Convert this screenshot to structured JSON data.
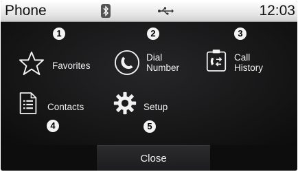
{
  "status": {
    "title": "Phone",
    "time": "12:03"
  },
  "menu": {
    "favorites": {
      "badge": "1",
      "label": "Favorites"
    },
    "dial": {
      "badge": "2",
      "line1": "Dial",
      "line2": "Number"
    },
    "history": {
      "badge": "3",
      "line1": "Call",
      "line2": "History"
    },
    "contacts": {
      "badge": "4",
      "label": "Contacts"
    },
    "setup": {
      "badge": "5",
      "label": "Setup"
    }
  },
  "footer": {
    "close_label": "Close"
  },
  "icons": [
    "bluetooth-icon",
    "usb-icon",
    "star-icon",
    "phone-handset-icon",
    "call-history-icon",
    "contacts-icon",
    "gear-icon"
  ]
}
